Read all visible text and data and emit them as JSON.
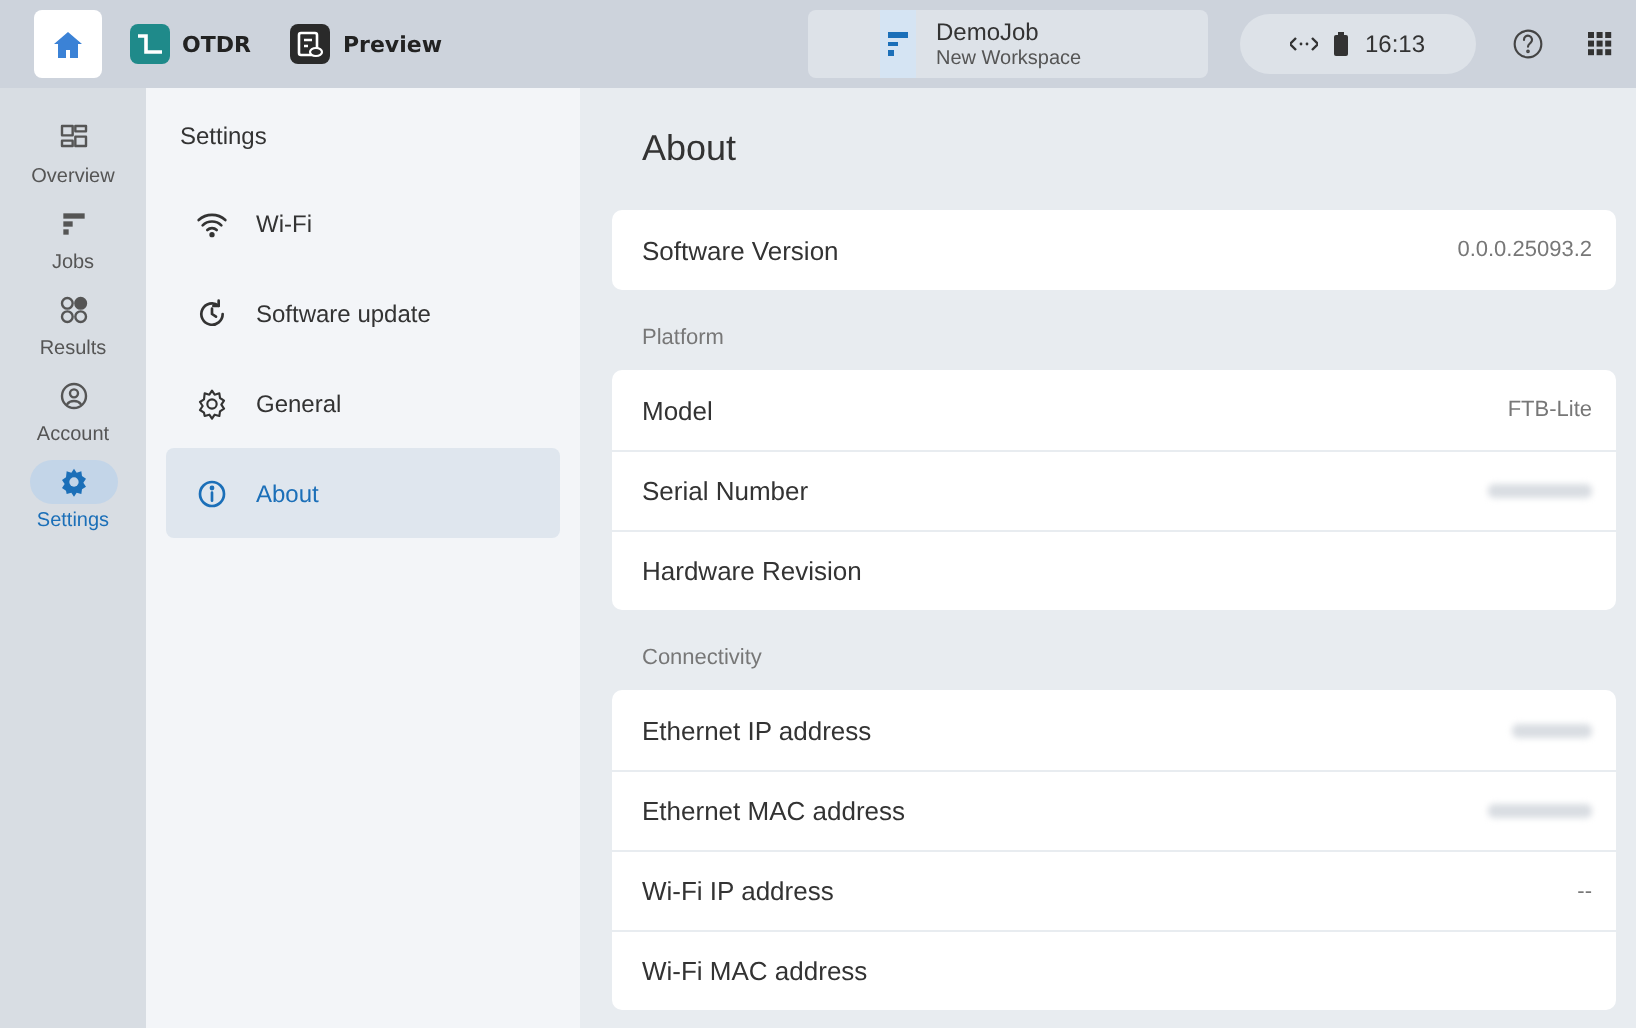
{
  "top_bar": {
    "apps": [
      {
        "kind": "home",
        "selected": true
      },
      {
        "kind": "otdr",
        "label": "OTDR",
        "selected": false
      },
      {
        "kind": "preview",
        "label": "Preview",
        "selected": false
      }
    ],
    "job": {
      "title": "DemoJob",
      "subtitle": "New Workspace"
    },
    "status": {
      "time": "16:13"
    }
  },
  "rail": {
    "items": [
      {
        "kind": "overview",
        "label": "Overview",
        "selected": false
      },
      {
        "kind": "jobs",
        "label": "Jobs",
        "selected": false
      },
      {
        "kind": "results",
        "label": "Results",
        "selected": false
      },
      {
        "kind": "account",
        "label": "Account",
        "selected": false
      },
      {
        "kind": "settings",
        "label": "Settings",
        "selected": true
      }
    ]
  },
  "settings_menu": {
    "title": "Settings",
    "items": [
      {
        "kind": "wifi",
        "label": "Wi-Fi",
        "selected": false
      },
      {
        "kind": "update",
        "label": "Software update",
        "selected": false
      },
      {
        "kind": "general",
        "label": "General",
        "selected": false
      },
      {
        "kind": "about",
        "label": "About",
        "selected": true
      }
    ]
  },
  "page": {
    "title": "About",
    "sections": [
      {
        "rows": [
          {
            "label": "Software Version",
            "kind": "text",
            "value": "0.0.0.25093.2"
          }
        ]
      },
      {
        "heading": "Platform",
        "rows": [
          {
            "label": "Model",
            "kind": "text",
            "value": "FTB-Lite"
          },
          {
            "label": "Serial Number",
            "kind": "redacted"
          },
          {
            "label": "Hardware Revision",
            "kind": "empty"
          }
        ]
      },
      {
        "heading": "Connectivity",
        "rows": [
          {
            "label": "Ethernet IP address",
            "kind": "redacted"
          },
          {
            "label": "Ethernet MAC address",
            "kind": "redacted"
          },
          {
            "label": "Wi-Fi IP address",
            "kind": "text",
            "value": "--"
          },
          {
            "label": "Wi-Fi MAC address",
            "kind": "empty"
          }
        ]
      }
    ]
  }
}
